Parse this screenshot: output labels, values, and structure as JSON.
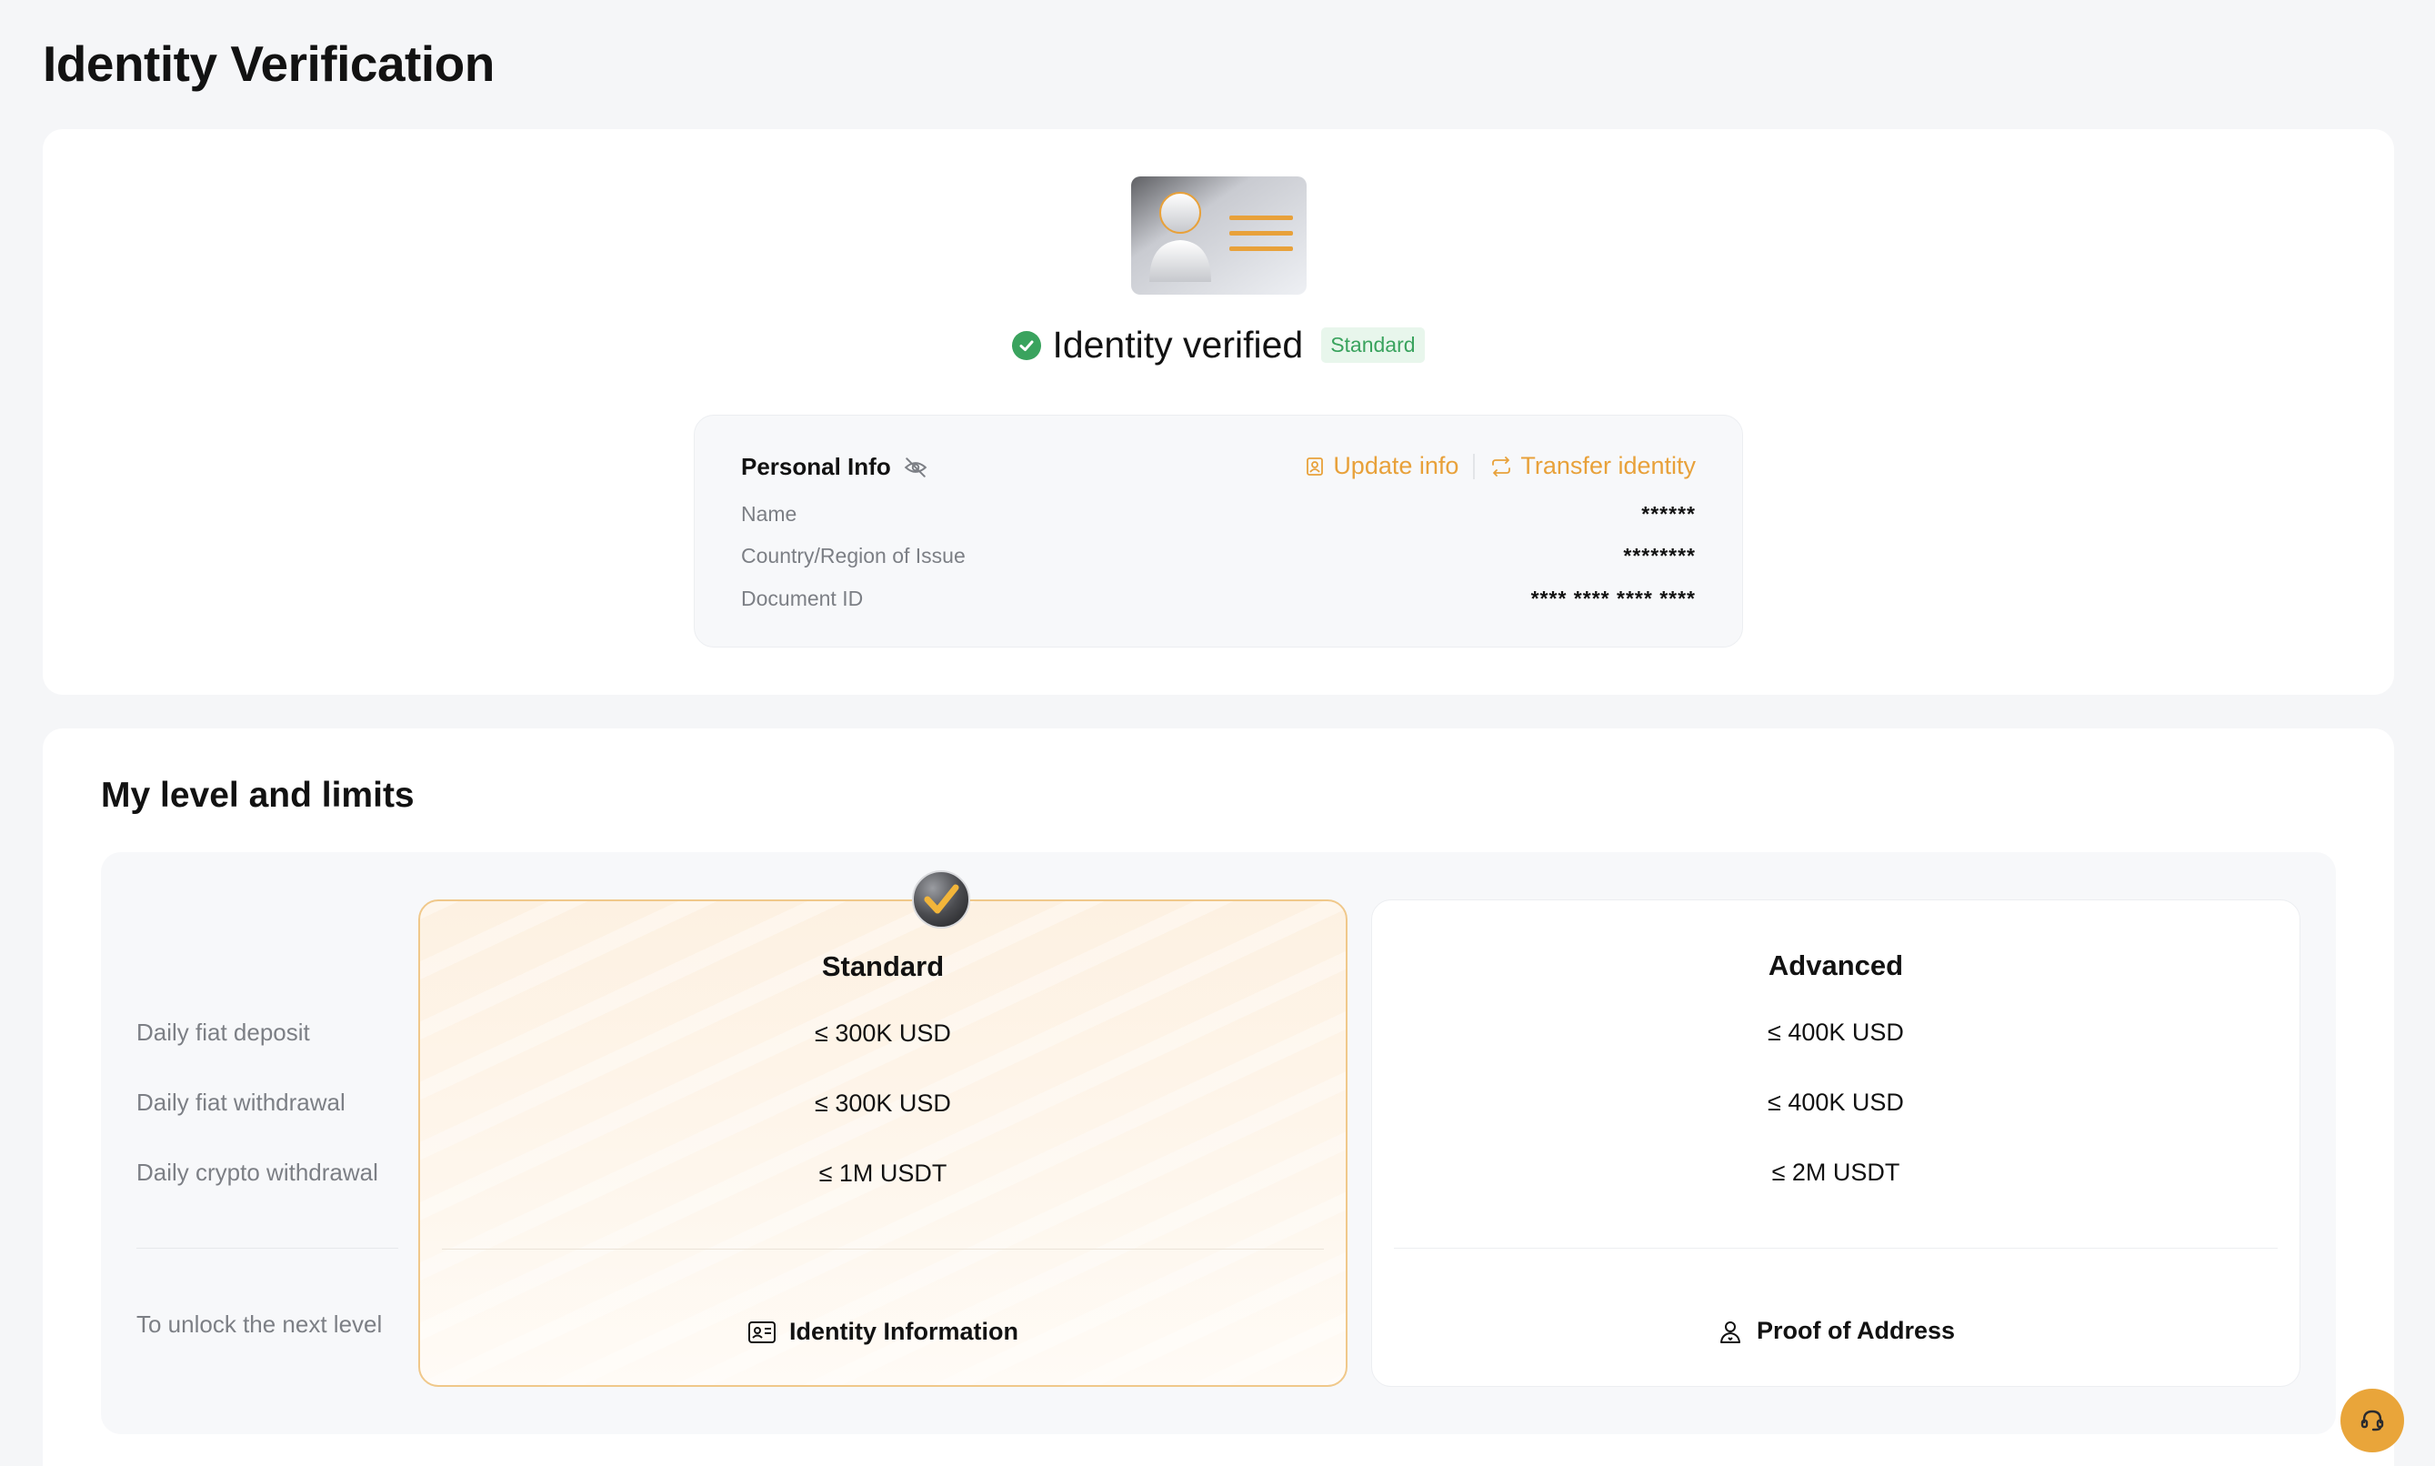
{
  "page": {
    "title": "Identity Verification"
  },
  "identity": {
    "status_text": "Identity verified",
    "level_badge": "Standard",
    "status_color": "#3aa35e"
  },
  "personal_info": {
    "title": "Personal Info",
    "actions": {
      "update": "Update info",
      "transfer": "Transfer identity"
    },
    "fields": [
      {
        "label": "Name",
        "value": "******"
      },
      {
        "label": "Country/Region of Issue",
        "value": "********"
      },
      {
        "label": "Document ID",
        "value": "**** **** **** ****"
      }
    ]
  },
  "levels": {
    "title": "My level and limits",
    "row_labels": [
      "Daily fiat deposit",
      "Daily fiat withdrawal",
      "Daily crypto withdrawal"
    ],
    "unlock_label": "To unlock the next level",
    "columns": [
      {
        "name": "Standard",
        "current": true,
        "values": [
          "≤ 300K USD",
          "≤ 300K USD",
          "≤ 1M USDT"
        ],
        "requirement": "Identity Information",
        "requirement_icon": "id-card-icon"
      },
      {
        "name": "Advanced",
        "current": false,
        "values": [
          "≤ 400K USD",
          "≤ 400K USD",
          "≤ 2M USDT"
        ],
        "requirement": "Proof of Address",
        "requirement_icon": "location-user-icon"
      }
    ]
  },
  "colors": {
    "accent": "#e8a13a",
    "success": "#3aa35e",
    "background": "#f5f6f8"
  }
}
